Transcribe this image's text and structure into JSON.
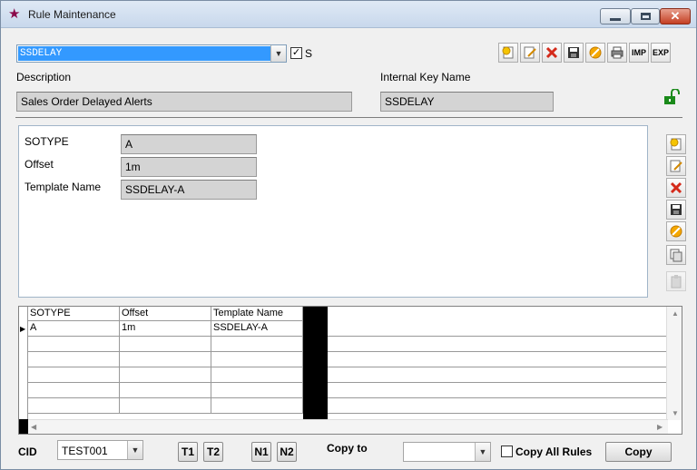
{
  "window": {
    "title": "Rule Maintenance",
    "close_glyph": "✕"
  },
  "rule_select": {
    "value": "SSDELAY",
    "checkbox_label": "S",
    "checked": true
  },
  "toolbar": {
    "imp_label": "IMP",
    "exp_label": "EXP"
  },
  "labels": {
    "description": "Description",
    "internal_key": "Internal Key Name"
  },
  "fields": {
    "description": "Sales Order Delayed Alerts",
    "internal_key": "SSDELAY"
  },
  "detail": {
    "rows": [
      {
        "label": "SOTYPE",
        "value": "A"
      },
      {
        "label": "Offset",
        "value": "1m"
      },
      {
        "label": "Template Name",
        "value": "SSDELAY-A"
      }
    ]
  },
  "grid": {
    "columns": [
      "SOTYPE",
      "Offset",
      "Template Name"
    ],
    "rows": [
      [
        "A",
        "1m",
        "SSDELAY-A"
      ]
    ],
    "current_row_marker": "▶"
  },
  "footer": {
    "cid_label": "CID",
    "cid_value": "TEST001",
    "t1": "T1",
    "t2": "T2",
    "n1": "N1",
    "n2": "N2",
    "copy_to_label": "Copy to",
    "copy_to_value": "",
    "copy_all_label": "Copy All Rules",
    "copy_button": "Copy"
  },
  "colors": {
    "selection": "#3399ff",
    "lock": "#1a8a1a"
  }
}
